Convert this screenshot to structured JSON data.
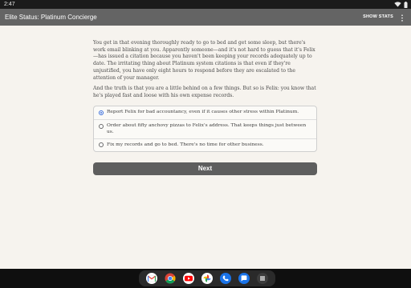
{
  "status_bar": {
    "time": "2:47"
  },
  "app_bar": {
    "title": "Elite Status: Platinum Concierge",
    "show_stats_label": "SHOW STATS"
  },
  "story": {
    "paragraphs": [
      "You get in that evening thoroughly ready to go to bed and get some sleep, but there's work email blinking at you. Apparently someone—and it's not hard to guess that it's Felix—has issued a citation because you haven't been keeping your records adequately up to date. The irritating thing about Platinum system citations is that even if they're unjustified, you have only eight hours to respond before they are escalated to the attention of your manager.",
      "And the truth is that you are a little behind on a few things. But so is Felix: you know that he's played fast and loose with his own expense records."
    ]
  },
  "choices": [
    {
      "label": "Report Felix for bad accountancy, even if it causes other stress within Platinum.",
      "selected": true
    },
    {
      "label": "Order about fifty anchovy pizzas to Felix's address. That keeps things just between us.",
      "selected": false
    },
    {
      "label": "Fix my records and go to bed. There's no time for other business.",
      "selected": false
    }
  ],
  "next_button": {
    "label": "Next"
  },
  "dock": {
    "apps": [
      "gmail-icon",
      "chrome-icon",
      "youtube-icon",
      "photos-icon",
      "phone-icon",
      "messages-icon",
      "app-drawer-icon"
    ]
  },
  "colors": {
    "app_bar": "#646464",
    "content_background": "#f6f3ee",
    "next_button": "#5e5e5e",
    "radio_selected": "#3a6dd8"
  }
}
